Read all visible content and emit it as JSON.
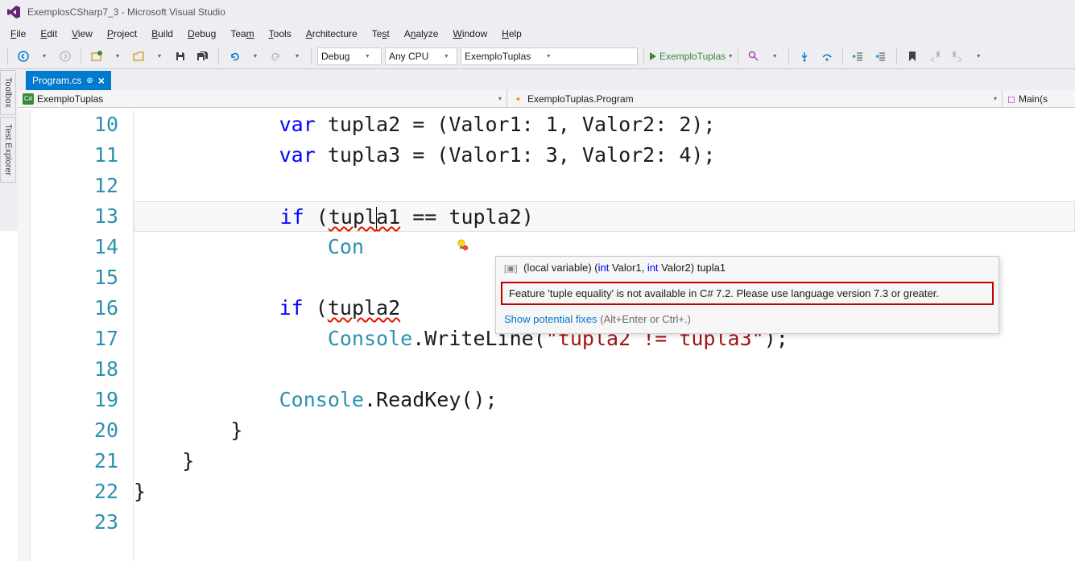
{
  "title": "ExemplosCSharp7_3 - Microsoft Visual Studio",
  "menu": [
    "File",
    "Edit",
    "View",
    "Project",
    "Build",
    "Debug",
    "Team",
    "Tools",
    "Architecture",
    "Test",
    "Analyze",
    "Window",
    "Help"
  ],
  "toolbarCombos": {
    "config": "Debug",
    "platform": "Any CPU",
    "project": "ExemploTuplas",
    "startup": "ExemploTuplas"
  },
  "sideTabs": [
    "Toolbox",
    "Test Explorer"
  ],
  "docTab": "Program.cs",
  "navbar": {
    "left": "ExemploTuplas",
    "center": "ExemploTuplas.Program",
    "right": "Main(s"
  },
  "lines": {
    "start": 10,
    "end": 23
  },
  "code": {
    "l10_var": "var",
    "l10_rest": " tupla2 = (Valor1: 1, Valor2: 2);",
    "l11_var": "var",
    "l11_rest": " tupla3 = (Valor1: 3, Valor2: 4);",
    "l13_if": "if",
    "l13_open": " (",
    "l13_t1a": "tupl",
    "l13_t1b": "a1",
    "l13_mid": " == ",
    "l13_t2": "tupla2",
    "l13_close": ")",
    "l14_con": "Con",
    "l16_if": "if",
    "l16_open": " (",
    "l16_t2": "tupla2",
    "l17_console": "Console",
    "l17_write": ".WriteLine(",
    "l17_str": "\"tupla2 != tupla3\"",
    "l17_end": ");",
    "l19_console": "Console",
    "l19_read": ".ReadKey();",
    "l20_brace": "}",
    "l21_brace": "}",
    "l22_brace": "}"
  },
  "tooltip": {
    "sig_prefix": "(local variable) (",
    "sig_kw1": "int",
    "sig_p1": " Valor1, ",
    "sig_kw2": "int",
    "sig_p2": " Valor2) tupla1",
    "error": "Feature 'tuple equality' is not available in C# 7.2. Please use language version 7.3 or greater.",
    "fix_link": "Show potential fixes",
    "fix_hint": " (Alt+Enter or Ctrl+.)"
  }
}
